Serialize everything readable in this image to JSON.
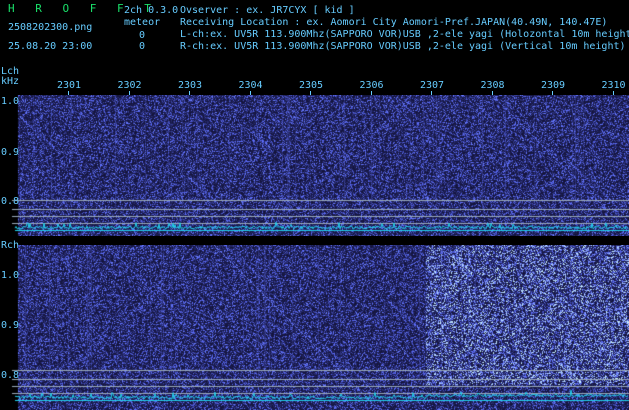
{
  "header": {
    "brand": "H R O F F T",
    "mode": "2ch 0.3.0",
    "filename": "2508202300.png",
    "meteor_label": "meteor",
    "meteor_count_l": "0",
    "meteor_count_r": "0",
    "datetime": "25.08.20 23:00"
  },
  "info": {
    "observer": "Ovserver           : ex. JR7CYX [ kid ]",
    "location": "Receiving Location : ex. Aomori City Aomori-Pref.JAPAN(40.49N, 140.47E)",
    "lch": "L-ch:ex. UV5R 113.900Mhz(SAPPORO VOR)USB ,2-ele yagi (Holozontal 10m height)",
    "rch": "R-ch:ex. UV5R 113.900Mhz(SAPPORO VOR)USB ,2-ele yagi (Vertical 10m height)"
  },
  "lch": {
    "label": "Lch",
    "unit": "kHz",
    "ticks": [
      "1.0",
      "0.9",
      "0.8"
    ]
  },
  "rch": {
    "label": "Rch",
    "ticks": [
      "1.0",
      "0.9",
      "0.8"
    ]
  },
  "time_axis": [
    "2301",
    "2302",
    "2303",
    "2304",
    "2305",
    "2306",
    "2307",
    "2308",
    "2309",
    "2310"
  ],
  "colors": {
    "text": "#66ccff",
    "brand": "#19e06a",
    "trace": "#22d3ee",
    "lines": "#9aaabb"
  }
}
